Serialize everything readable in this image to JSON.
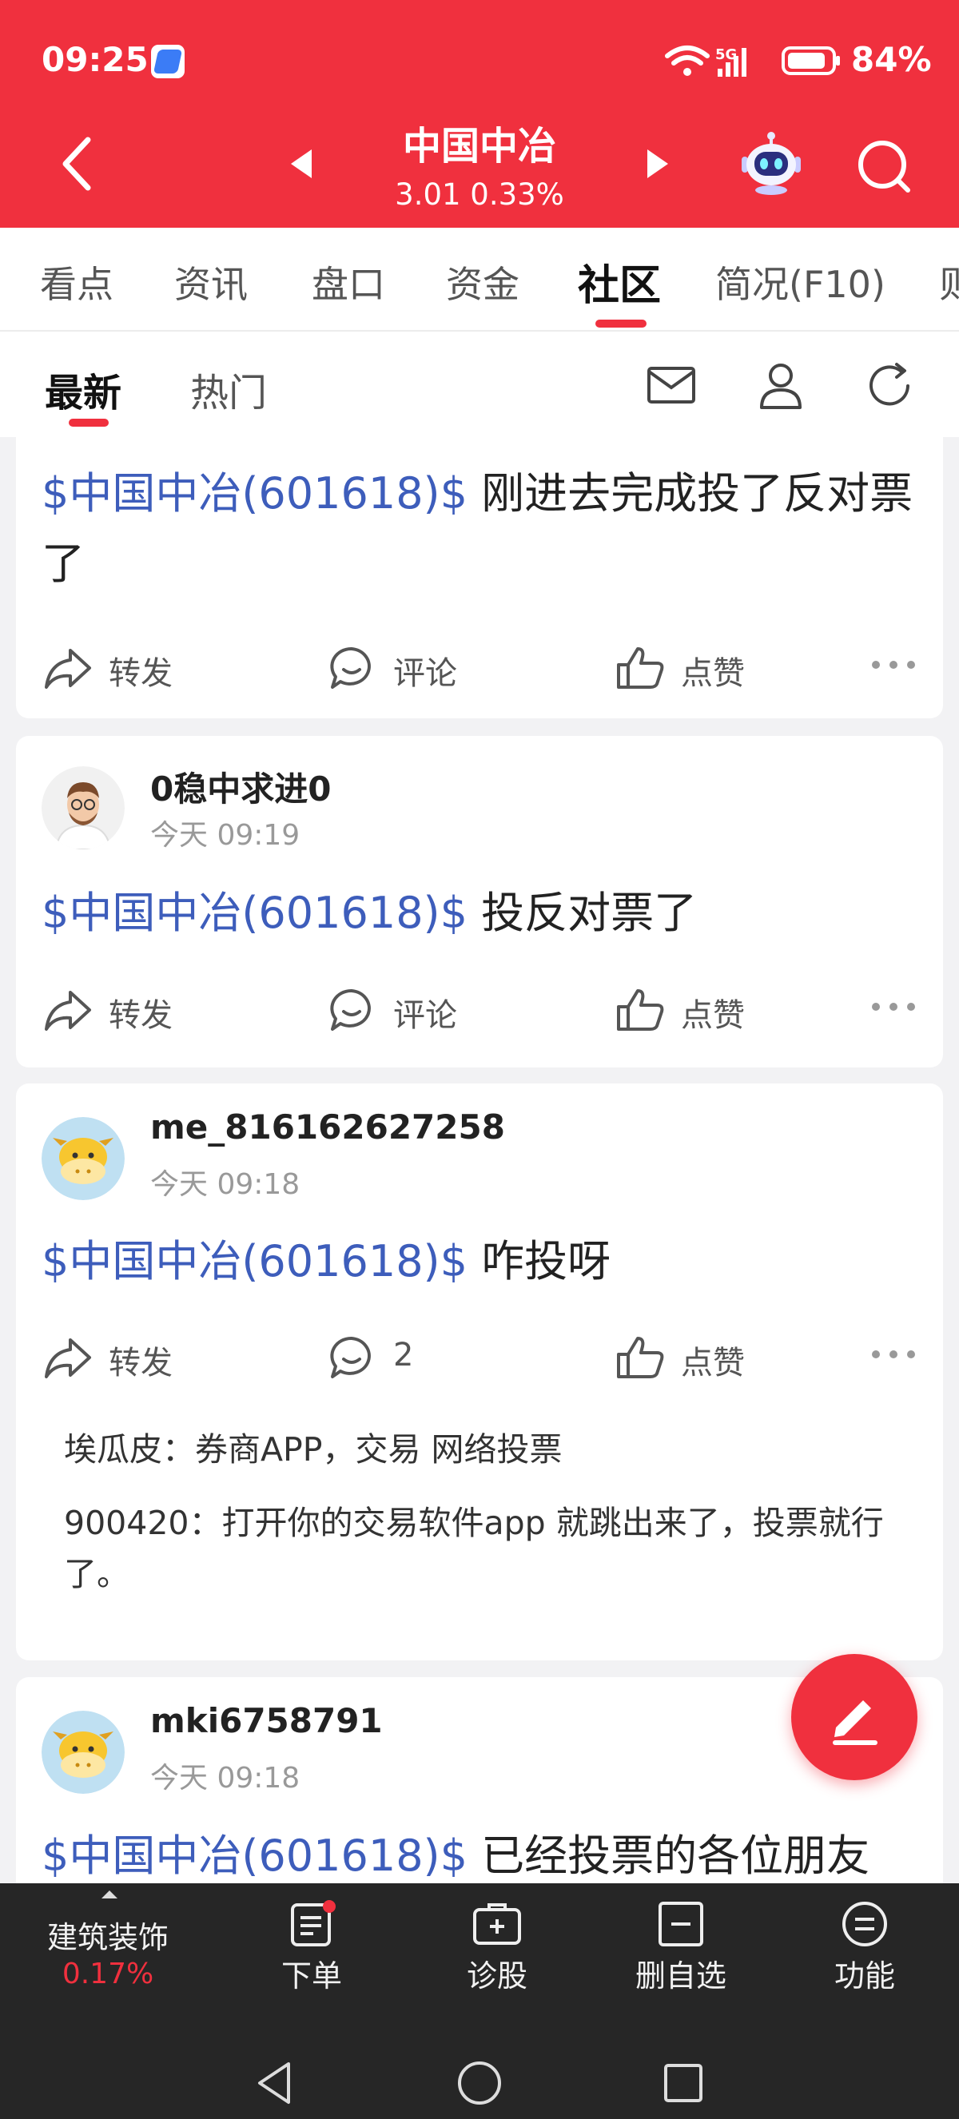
{
  "status_bar": {
    "time": "09:25",
    "network": "5G",
    "battery": "84%"
  },
  "header": {
    "stock_name": "中国中冶",
    "price_change": "3.01 0.33%"
  },
  "tabs": [
    "看点",
    "资讯",
    "盘口",
    "资金",
    "社区",
    "简况(F10)",
    "则"
  ],
  "active_tab": "社区",
  "subtabs": {
    "latest": "最新",
    "hot": "热门"
  },
  "actions": {
    "repost": "转发",
    "comment": "评论",
    "like": "点赞"
  },
  "posts": [
    {
      "tag": "$中国中冶(601618)$",
      "text": " 刚进去完成投了反对票了"
    },
    {
      "user": "0稳中求进0",
      "time": "今天 09:19",
      "tag": "$中国中冶(601618)$",
      "text": " 投反对票了"
    },
    {
      "user": "me_816162627258",
      "time": "今天 09:18",
      "tag": "$中国中冶(601618)$",
      "text": " 咋投呀",
      "comment_count": "2",
      "comments": [
        {
          "author": "埃瓜皮",
          "sep": "：",
          "text": "券商APP，交易 网络投票"
        },
        {
          "author": "900420",
          "sep": "：",
          "text": "打开你的交易软件app 就跳出来了，投票就行了。"
        }
      ]
    },
    {
      "user": "mki6758791",
      "time": "今天 09:18",
      "tag": "$中国中冶(601618)$",
      "text": " 已经投票的各位朋友"
    }
  ],
  "bottom_bar": {
    "sector_name": "建筑装饰",
    "sector_change": "0.17%",
    "order": "下单",
    "diagnose": "诊股",
    "remove_watch": "删自选",
    "functions": "功能"
  },
  "colors": {
    "brand_red": "#f0303e",
    "tag_blue": "#3d5dbb",
    "bottom_bar": "#262626"
  }
}
